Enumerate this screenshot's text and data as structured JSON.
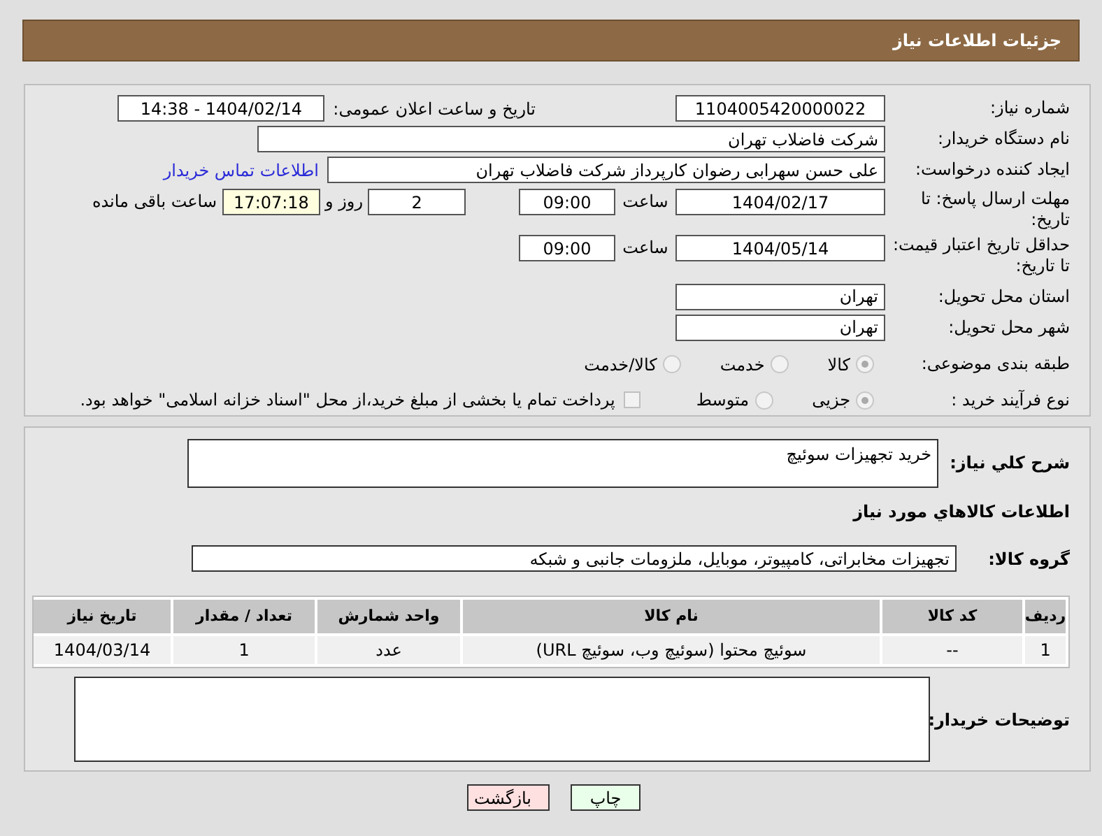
{
  "header": {
    "title": "جزئیات اطلاعات نیاز"
  },
  "need_number": {
    "label": "شماره نیاز:",
    "value": "1104005420000022"
  },
  "announce": {
    "label": "تاریخ و ساعت اعلان عمومی:",
    "value": "1404/02/14 - 14:38"
  },
  "buyer": {
    "label": "نام دستگاه خریدار:",
    "value": "شرکت فاضلاب تهران"
  },
  "creator": {
    "label": "ایجاد کننده درخواست:",
    "value": "علی حسن  سهرابی رضوان کارپرداز شرکت فاضلاب تهران",
    "link": "اطلاعات تماس خریدار"
  },
  "deadline": {
    "label": "مهلت ارسال پاسخ: تا تاریخ:",
    "date": "1404/02/17",
    "time_label": "ساعت",
    "time": "09:00",
    "days": "2",
    "days_label": "روز و",
    "remaining": "17:07:18",
    "remaining_label": "ساعت باقی مانده"
  },
  "validity": {
    "label": "حداقل تاریخ اعتبار قیمت: تا تاریخ:",
    "date": "1404/05/14",
    "time_label": "ساعت",
    "time": "09:00"
  },
  "province": {
    "label": "استان محل تحویل:",
    "value": "تهران"
  },
  "city": {
    "label": "شهر محل تحویل:",
    "value": "تهران"
  },
  "category": {
    "label": "طبقه بندی موضوعی:",
    "disabled": true,
    "options": [
      {
        "label": "کالا",
        "selected": true
      },
      {
        "label": "خدمت",
        "selected": false
      },
      {
        "label": "کالا/خدمت",
        "selected": false
      }
    ]
  },
  "process": {
    "label": "نوع فرآیند خرید :",
    "disabled": true,
    "options": [
      {
        "label": "جزیی",
        "selected": true
      },
      {
        "label": "متوسط",
        "selected": false
      }
    ],
    "payment": {
      "label": "پرداخت تمام یا بخشی از مبلغ خرید،از محل \"اسناد خزانه اسلامی\" خواهد بود.",
      "checked": false
    }
  },
  "description": {
    "label": "شرح كلي نياز:",
    "value": "خرید تجهیزات سوئیچ"
  },
  "goods_title": "اطلاعات كالاهاي مورد نياز",
  "group": {
    "label": "گروه کالا:",
    "value": "تجهیزات مخابراتی، کامپیوتر، موبایل، ملزومات جانبی و شبکه"
  },
  "table": {
    "columns": [
      "رديف",
      "کد کالا",
      "نام کالا",
      "واحد شمارش",
      "تعداد / مقدار",
      "تاریخ نیاز"
    ],
    "rows": [
      [
        "1",
        "--",
        "سوئیچ محتوا (سوئیچ وب، سوئیچ URL)",
        "عدد",
        "1",
        "1404/03/14"
      ]
    ]
  },
  "notes": {
    "label": "توضیحات خریدار:"
  },
  "buttons": [
    {
      "label": "چاپ",
      "kind": "print"
    },
    {
      "label": "بازگشت",
      "kind": "back"
    }
  ]
}
